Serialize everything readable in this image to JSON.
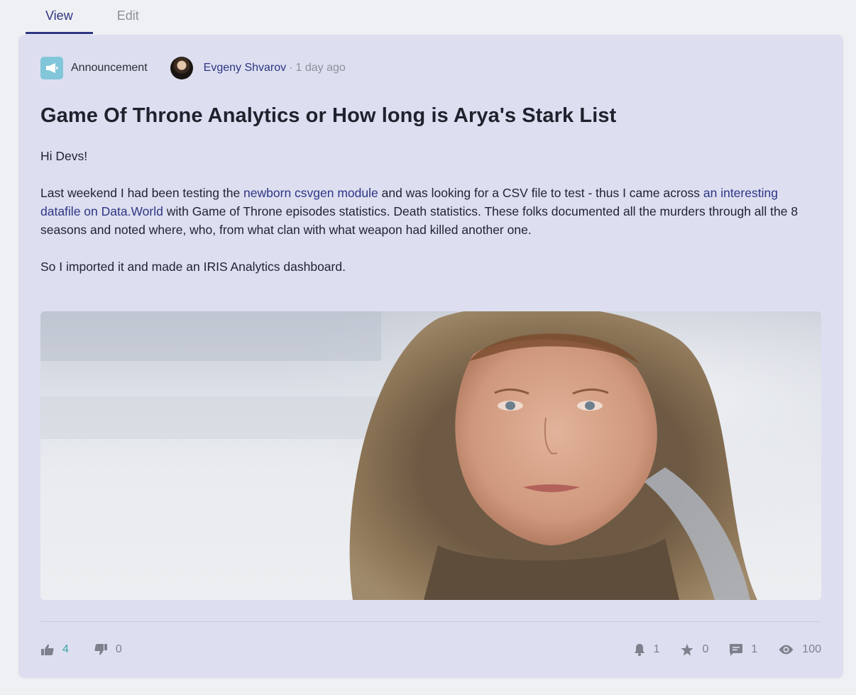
{
  "tabs": [
    {
      "label": "View",
      "active": true
    },
    {
      "label": "Edit",
      "active": false
    }
  ],
  "post": {
    "type_label": "Announcement",
    "type_icon": "megaphone-icon",
    "author": "Evgeny Shvarov",
    "separator": "·",
    "time": "1 day ago",
    "title": "Game Of Throne Analytics or How long is Arya's Stark List",
    "greeting": "Hi Devs!",
    "p2_text1": "Last weekend I had been testing the ",
    "p2_link1": "newborn csvgen module",
    "p2_text2": " and was looking for a CSV file to test - thus I came across ",
    "p2_link2": "an interesting datafile on Data.World",
    "p2_text3": " with Game of Throne episodes statistics. Death statistics. These folks documented all the murders through all the 8 seasons and noted where, who, from what clan with what weapon had killed another one.",
    "p3": "So I imported it and made an IRIS Analytics dashboard.",
    "image_subject": "portrait-in-fur-hood-snowy-background"
  },
  "stats": {
    "likes": "4",
    "dislikes": "0",
    "subscriptions": "1",
    "bookmarks": "0",
    "comments": "1",
    "views": "100"
  },
  "colors": {
    "accent": "#2d3584",
    "card_bg": "#dddff0",
    "page_bg": "#eff0f3",
    "like": "#3aa6a5",
    "announcement_icon_bg": "#82c6d9"
  }
}
